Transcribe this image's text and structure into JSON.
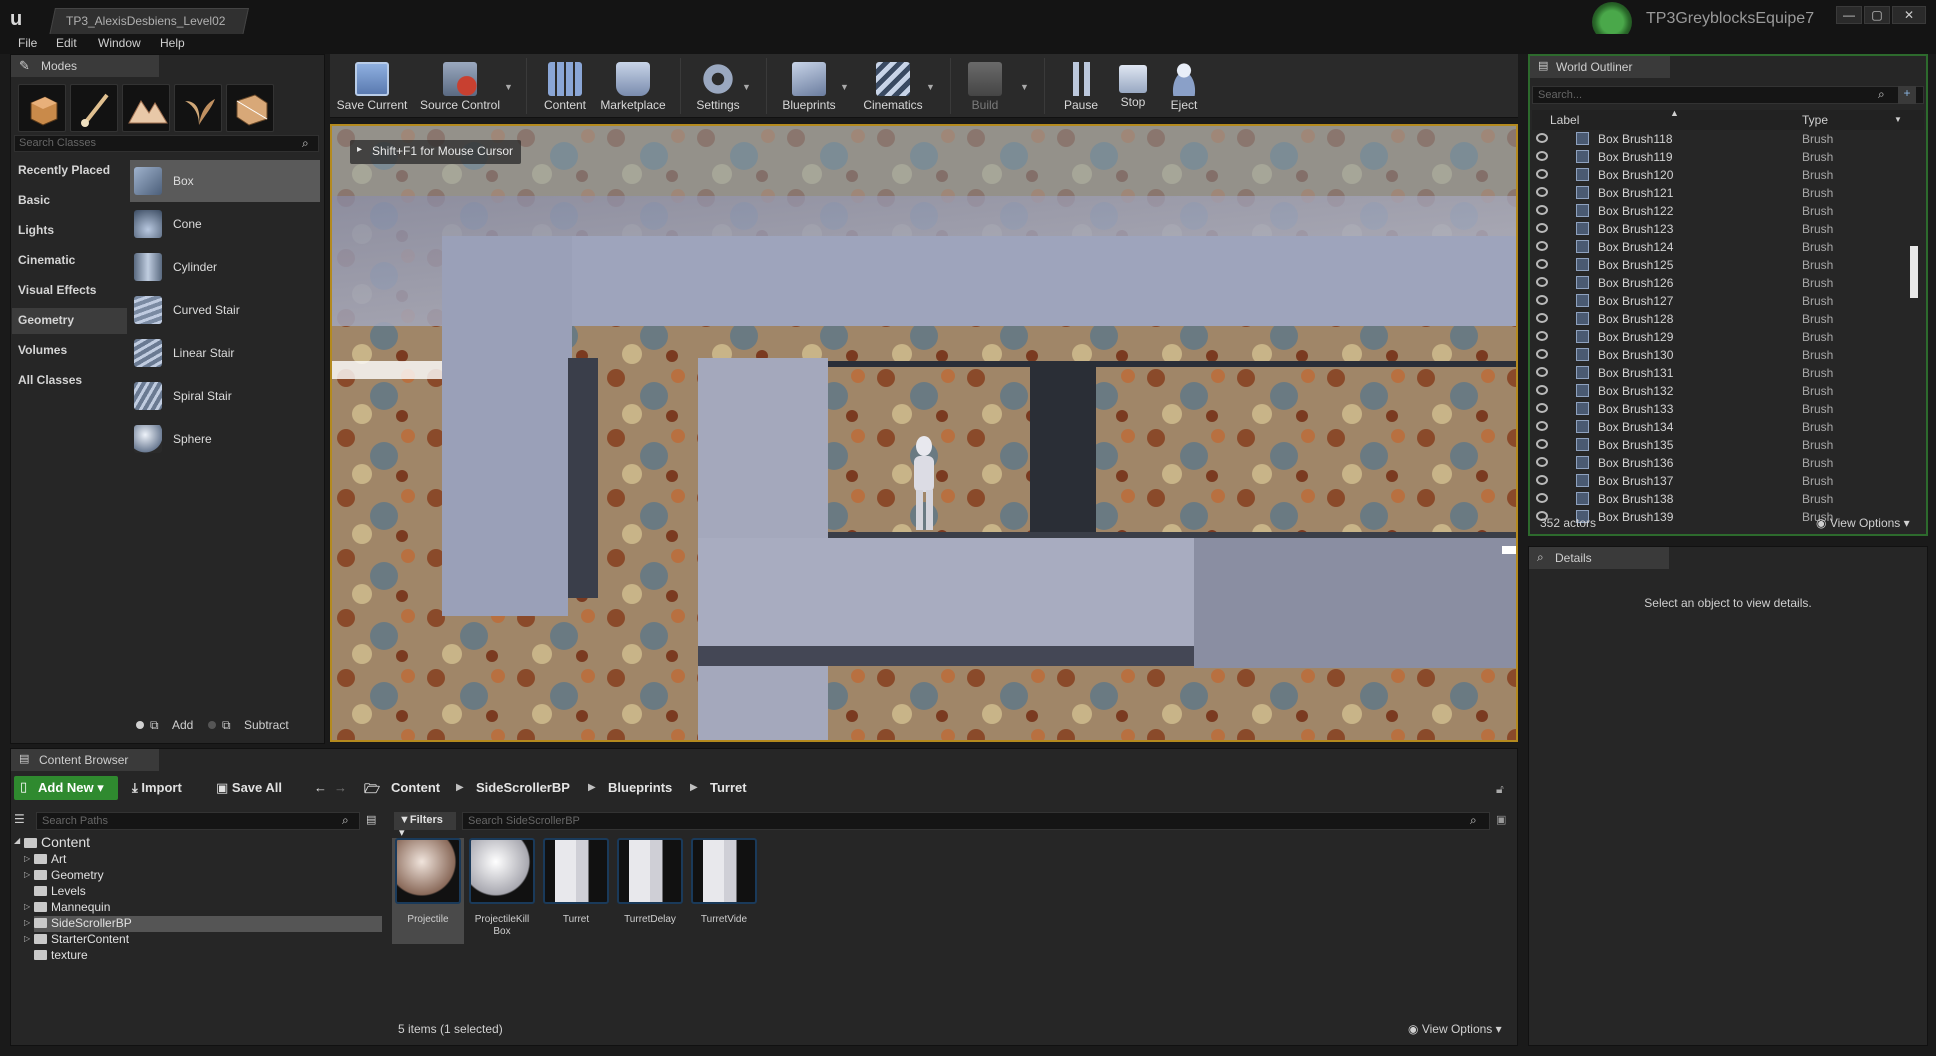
{
  "window": {
    "doc_tab": "TP3_AlexisDesbiens_Level02",
    "project_name": "TP3GreyblocksEquipe7",
    "controls": [
      "—",
      "▢",
      "✕"
    ]
  },
  "menu": [
    "File",
    "Edit",
    "Window",
    "Help"
  ],
  "modes": {
    "tab_label": "Modes",
    "search_placeholder": "Search Classes",
    "categories": [
      "Recently Placed",
      "Basic",
      "Lights",
      "Cinematic",
      "Visual Effects",
      "Geometry",
      "Volumes",
      "All Classes"
    ],
    "active_category": "Geometry",
    "shapes": [
      "Box",
      "Cone",
      "Cylinder",
      "Curved Stair",
      "Linear Stair",
      "Spiral Stair",
      "Sphere"
    ],
    "selected_shape": "Box",
    "add_label": "Add",
    "subtract_label": "Subtract"
  },
  "toolbar": {
    "save_current": "Save Current",
    "source_control": "Source Control",
    "content": "Content",
    "marketplace": "Marketplace",
    "settings": "Settings",
    "blueprints": "Blueprints",
    "cinematics": "Cinematics",
    "build": "Build",
    "pause": "Pause",
    "stop": "Stop",
    "eject": "Eject"
  },
  "viewport": {
    "hint": "Shift+F1 for Mouse Cursor"
  },
  "outliner": {
    "tab_label": "World Outliner",
    "search_placeholder": "Search...",
    "col_label": "Label",
    "col_type": "Type",
    "rows": [
      {
        "name": "Box Brush118",
        "type": "Brush"
      },
      {
        "name": "Box Brush119",
        "type": "Brush"
      },
      {
        "name": "Box Brush120",
        "type": "Brush"
      },
      {
        "name": "Box Brush121",
        "type": "Brush"
      },
      {
        "name": "Box Brush122",
        "type": "Brush"
      },
      {
        "name": "Box Brush123",
        "type": "Brush"
      },
      {
        "name": "Box Brush124",
        "type": "Brush"
      },
      {
        "name": "Box Brush125",
        "type": "Brush"
      },
      {
        "name": "Box Brush126",
        "type": "Brush"
      },
      {
        "name": "Box Brush127",
        "type": "Brush"
      },
      {
        "name": "Box Brush128",
        "type": "Brush"
      },
      {
        "name": "Box Brush129",
        "type": "Brush"
      },
      {
        "name": "Box Brush130",
        "type": "Brush"
      },
      {
        "name": "Box Brush131",
        "type": "Brush"
      },
      {
        "name": "Box Brush132",
        "type": "Brush"
      },
      {
        "name": "Box Brush133",
        "type": "Brush"
      },
      {
        "name": "Box Brush134",
        "type": "Brush"
      },
      {
        "name": "Box Brush135",
        "type": "Brush"
      },
      {
        "name": "Box Brush136",
        "type": "Brush"
      },
      {
        "name": "Box Brush137",
        "type": "Brush"
      },
      {
        "name": "Box Brush138",
        "type": "Brush"
      },
      {
        "name": "Box Brush139",
        "type": "Brush"
      }
    ],
    "actor_count": "352 actors",
    "view_options": "View Options"
  },
  "details": {
    "tab_label": "Details",
    "message": "Select an object to view details."
  },
  "content_browser": {
    "tab_label": "Content Browser",
    "add_new": "Add New",
    "import": "Import",
    "save_all": "Save All",
    "breadcrumbs": [
      "Content",
      "SideScrollerBP",
      "Blueprints",
      "Turret"
    ],
    "paths_placeholder": "Search Paths",
    "filters": "Filters",
    "asset_search_placeholder": "Search SideScrollerBP",
    "tree_root": "Content",
    "tree": [
      {
        "label": "Art",
        "expandable": true
      },
      {
        "label": "Geometry",
        "expandable": true
      },
      {
        "label": "Levels",
        "expandable": false
      },
      {
        "label": "Mannequin",
        "expandable": true
      },
      {
        "label": "SideScrollerBP",
        "expandable": true
      },
      {
        "label": "StarterContent",
        "expandable": true
      },
      {
        "label": "texture",
        "expandable": false
      }
    ],
    "selected_folder": "SideScrollerBP",
    "assets": [
      {
        "label": "Projectile",
        "kind": "sphere-dark"
      },
      {
        "label": "ProjectileKill Box",
        "kind": "sphere-light"
      },
      {
        "label": "Turret",
        "kind": "blueprint"
      },
      {
        "label": "TurretDelay",
        "kind": "blueprint"
      },
      {
        "label": "TurretVide",
        "kind": "blueprint"
      }
    ],
    "selected_asset": "Projectile",
    "status": "5 items (1 selected)",
    "view_options": "View Options"
  },
  "colors": {
    "accent_green": "#2f8a2f",
    "viewport_border": "#b48a1e",
    "outliner_border": "#2d6a2d"
  }
}
